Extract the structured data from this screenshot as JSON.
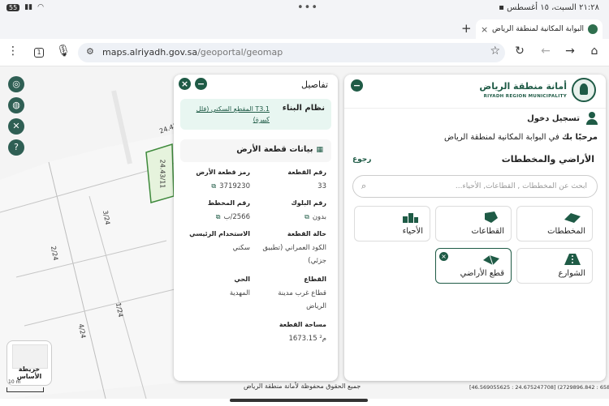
{
  "status": {
    "time": "٢١:٢٨",
    "date": "السبت، ١٥ أغسطس",
    "battery": "55"
  },
  "tab": {
    "title": "البوابة المكانية لمنطقة الرياض",
    "close": "×"
  },
  "browser": {
    "new_tab": "+",
    "url_host": "maps.alriyadh.gov.sa",
    "url_path": "/geoportal/geomap",
    "tab_count": "1"
  },
  "map": {
    "labels": {
      "l1": "24.43",
      "l2": "24.43/11",
      "l3": "3/24",
      "l4": "2/24",
      "l5": "1/24",
      "l6": "4/24"
    },
    "basemap_label": "خريطة الأساس",
    "scale_label": "10 m"
  },
  "footer": {
    "copyright": "جميع الحقوق محفوظة لأمانة منطقة الرياض",
    "coords": "[46.569055625 : 24.675247708] (2729896.842 : 658759.600)"
  },
  "right_panel": {
    "logo_ar": "أمانة منطقة الرياض",
    "logo_en": "RIYADH REGION MUNICIPALITY",
    "login": "تسجيل دخول",
    "welcome_prefix": "مرحبًا بك",
    "welcome_rest": "في البوابة المكانية لمنطقة الرياض",
    "section_title": "الأراضي والمخططات",
    "back": "رجوع",
    "search_placeholder": "ابحث عن المخططات , القطاعات, الأحياء...",
    "categories": [
      {
        "label": "المخططات",
        "icon": "plans-icon"
      },
      {
        "label": "القطاعات",
        "icon": "sectors-icon"
      },
      {
        "label": "الأحياء",
        "icon": "districts-icon"
      },
      {
        "label": "الشوارع",
        "icon": "streets-icon"
      },
      {
        "label": "قطع الأراضي",
        "icon": "parcels-icon"
      }
    ],
    "close_glyph": "×"
  },
  "details": {
    "title": "تفاصيل",
    "building_system_label": "نظام البناء",
    "building_system_value": "T3.1 المقطع السكني (فلل كبيرة)",
    "land_section_title": "بيانات قطعة الأرض",
    "fields": {
      "parcel_no_label": "رقم القطعة",
      "parcel_no": "33",
      "parcel_code_label": "رمز قطعة الأرض",
      "parcel_code": "3719230",
      "block_no_label": "رقم البلوك",
      "block_no": "بدون",
      "plan_no_label": "رقم المخطط",
      "plan_no": "2566/ب",
      "status_label": "حالة القطعة",
      "status": "الكود العمراني (تطبيق جزئي)",
      "main_use_label": "الاستخدام الرئيسي",
      "main_use": "سكني",
      "sector_label": "القطاع",
      "sector": "قطاع غرب مدينة الرياض",
      "district_label": "الحي",
      "district": "المهدية",
      "area_label": "مساحة القطعة",
      "area": "1673.15 م²"
    }
  },
  "colors": {
    "brand_green": "#1f5b46",
    "accent_teal": "#2f5f54",
    "box_mint": "#e8f6f1"
  }
}
